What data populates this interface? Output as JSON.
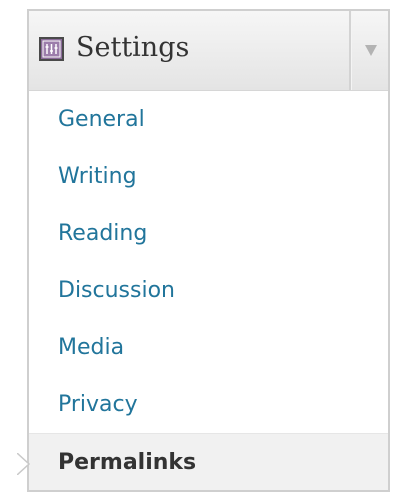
{
  "menu": {
    "title": "Settings",
    "icon": "settings-icon",
    "toggle_icon": "triangle-down-icon",
    "current_arrow_icon": "current-item-arrow-icon",
    "items": [
      {
        "label": "General"
      },
      {
        "label": "Writing"
      },
      {
        "label": "Reading"
      },
      {
        "label": "Discussion"
      },
      {
        "label": "Media"
      },
      {
        "label": "Privacy"
      },
      {
        "label": "Permalinks",
        "current": true
      }
    ]
  },
  "colors": {
    "link": "#21759b",
    "current_text": "#333333",
    "current_bg": "#f1f1f1",
    "border": "#cfcfcf",
    "header_gradient_top": "#f6f6f6",
    "header_gradient_bottom": "#e4e4e4"
  }
}
